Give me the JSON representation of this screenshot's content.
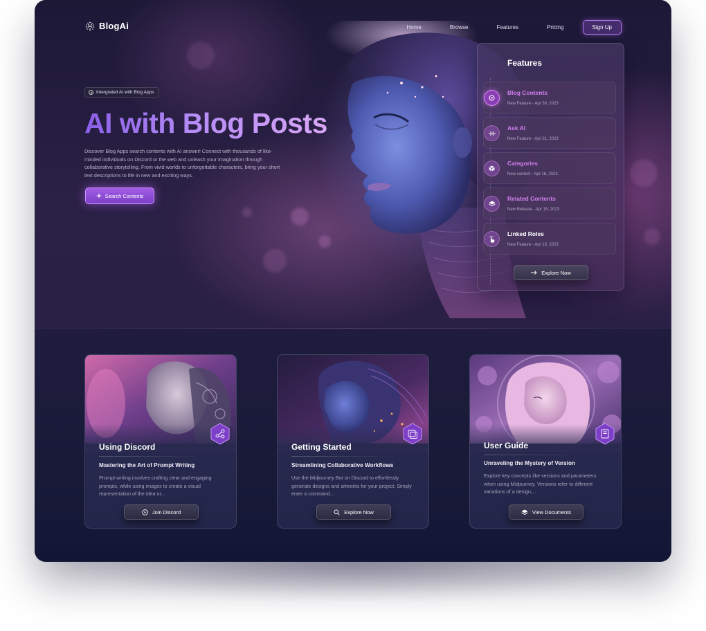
{
  "brand": {
    "name": "BlogAi",
    "icon": "dotted-sphere-icon"
  },
  "nav": {
    "links": [
      "Home",
      "Browse",
      "Features",
      "Pricing"
    ],
    "signup_label": "Sign Up"
  },
  "hero": {
    "tag": "Intergrated AI with Blog Apps",
    "title": "AI with Blog Posts",
    "description": "Discover Blog Apps search contents with AI answer! Connect with thousands of like-minded individuals on Discord or the web and unleash your imagination through collaborative storytelling. From vivid worlds to unforgettable characters, bring your short text descriptions to life in new and exciting ways.",
    "button_label": "Search Contents"
  },
  "features_panel": {
    "title": "Features",
    "items": [
      {
        "label": "Blog Contents",
        "meta": "New Feature - Apr 30, 2023",
        "icon": "target-icon",
        "accent": "#d27ff0"
      },
      {
        "label": "Ask AI",
        "meta": "New Feature - Apr 21, 2023",
        "icon": "waveform-icon",
        "accent": "#d27ff0"
      },
      {
        "label": "Categories",
        "meta": "New content - Apr 16, 2023",
        "icon": "cube-icon",
        "accent": "#d27ff0"
      },
      {
        "label": "Related Contents",
        "meta": "New Release - Apr 15, 2023",
        "icon": "layers-icon",
        "accent": "#d27ff0"
      },
      {
        "label": "Linked Roles",
        "meta": "New Feature - Apr 10, 2023",
        "icon": "hand-pointer-icon",
        "accent": "#ffffff"
      }
    ],
    "explore_label": "Explore Now"
  },
  "cards": [
    {
      "title": "Using Discord",
      "subtitle": "Mastering the Art of Prompt Writing",
      "description": "Prompt writing involves crafting clear and engaging prompts, while using images to create a visual representation of the idea or...",
      "button_label": "Join Discord",
      "button_icon": "play-circle-icon",
      "badge_icon": "nodes-icon"
    },
    {
      "title": "Getting Started",
      "subtitle": "Streamlining Collaborative Workflows",
      "description": "Use the Midjourney Bot on Discord to effortlessly generate designs and artworks for your project. Simply enter a command...",
      "button_label": "Explore Now",
      "button_icon": "search-icon",
      "badge_icon": "image-stack-icon"
    },
    {
      "title": "User Guide",
      "subtitle": "Unraveling the Mystery of Version",
      "description": "Explore key concepts like versions and parameters when using Midjourney. Versions refer to different variations of a design,...",
      "button_label": "View Documents",
      "button_icon": "layers-icon",
      "badge_icon": "book-icon"
    }
  ],
  "colors": {
    "accent_purple": "#a25de6",
    "background": "#1b1736",
    "card": "#2b2b52"
  }
}
